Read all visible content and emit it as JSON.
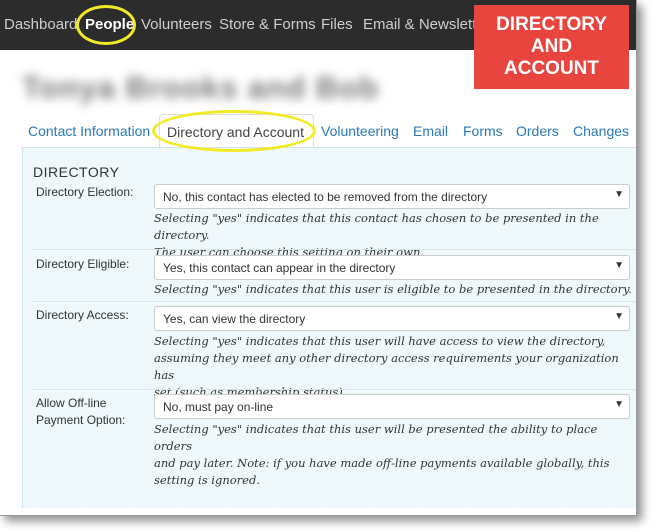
{
  "topnav": {
    "items": [
      "Dashboard",
      "People",
      "Volunteers",
      "Store & Forms",
      "Files",
      "Email & Newsletters"
    ]
  },
  "callout": {
    "lines": [
      "DIRECTORY",
      "AND",
      "ACCOUNT"
    ],
    "color": "#e8453f"
  },
  "person": {
    "name": "Tonya Brooks and Bob"
  },
  "tabs": [
    "Contact Information",
    "Directory and Account",
    "Volunteering",
    "Email",
    "Forms",
    "Orders",
    "Changes"
  ],
  "directory": {
    "section_title": "DIRECTORY",
    "fields": [
      {
        "label": "Directory Election:",
        "value": "No, this contact has elected to be removed from the directory",
        "help_lines": [
          "Selecting \"yes\" indicates that this contact has chosen to be presented in the directory.",
          "The user can choose this setting on their own."
        ]
      },
      {
        "label": "Directory Eligible:",
        "value": "Yes, this contact can appear in the directory",
        "help_lines": [
          "Selecting \"yes\" indicates that this user is eligible to be presented in the directory."
        ]
      },
      {
        "label": "Directory Access:",
        "value": "Yes, can view the directory",
        "help_lines": [
          "Selecting \"yes\" indicates that this user will have access to view the directory,",
          "assuming they meet any other directory access requirements your organization has",
          "set (such as membership status)."
        ]
      },
      {
        "label_lines": [
          "Allow Off-line",
          "Payment Option:"
        ],
        "value": "No, must pay on-line",
        "help_lines": [
          "Selecting \"yes\" indicates that this user will be presented the ability to place orders",
          "and pay later. Note: if you have made off-line payments available globally, this",
          "setting is ignored."
        ]
      }
    ]
  },
  "colors": {
    "nav_bg": "#2c2c2c",
    "link": "#2a78b8",
    "highlight": "#f2ea24",
    "panel_bg": "#eff8fb"
  }
}
